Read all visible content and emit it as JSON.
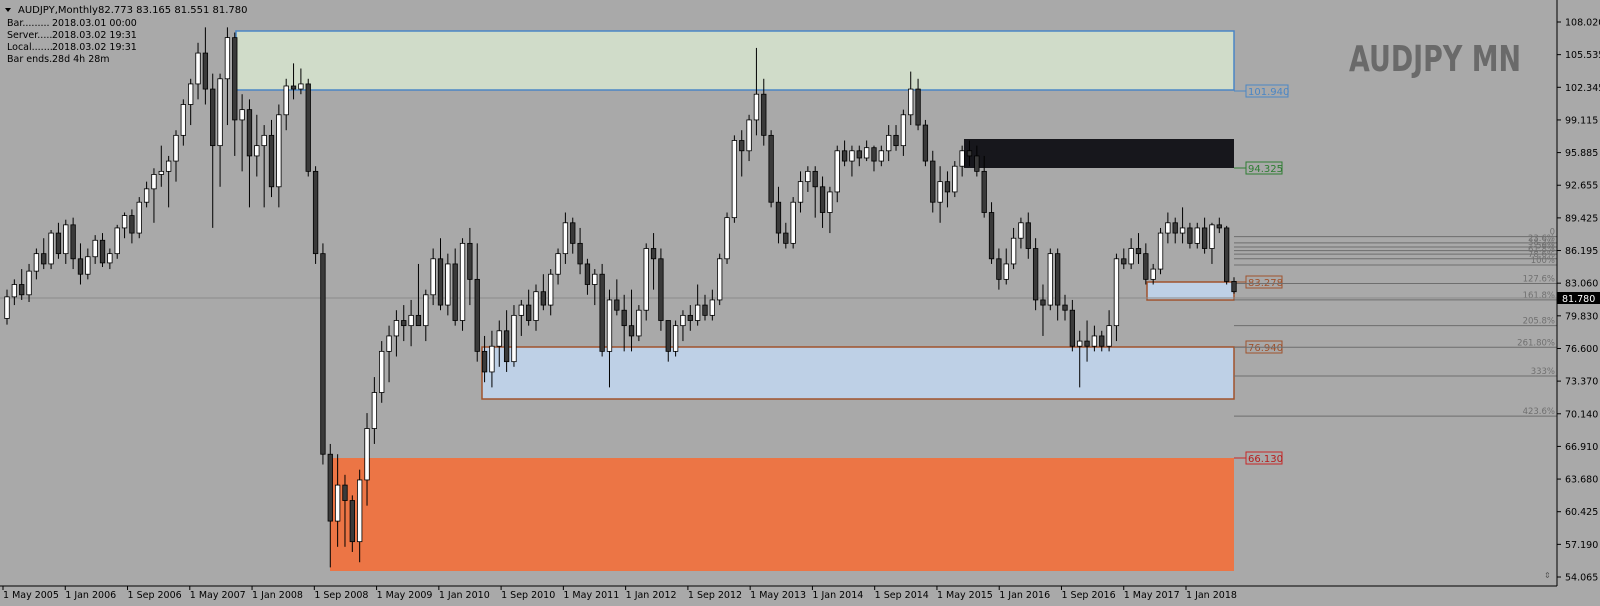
{
  "window": {
    "menu_icon": "triangle-down-icon",
    "symbol": "AUDJPY,Monthly",
    "ohlc": "82.773 83.165 81.551 81.780",
    "watermark": "AUDJPY MN"
  },
  "info_panel": [
    {
      "label": "Bar.........",
      "value": "2018.03.01 00:00"
    },
    {
      "label": "Server.....",
      "value": "2018.03.02 19:31"
    },
    {
      "label": "Local.......",
      "value": "2018.03.02 19:31"
    },
    {
      "label": "Bar ends..",
      "value": "28d 4h 28m"
    }
  ],
  "price_axis": {
    "ticks": [
      "108.020",
      "105.535",
      "102.345",
      "99.115",
      "95.885",
      "92.655",
      "89.425",
      "86.195",
      "83.060",
      "79.830",
      "76.600",
      "73.370",
      "70.140",
      "66.910",
      "63.680",
      "60.425",
      "57.190",
      "54.065"
    ],
    "current_price": "81.780"
  },
  "time_axis": {
    "ticks": [
      "1 May 2005",
      "1 Jan 2006",
      "1 Sep 2006",
      "1 May 2007",
      "1 Jan 2008",
      "1 Sep 2008",
      "1 May 2009",
      "1 Jan 2010",
      "1 Sep 2010",
      "1 May 2011",
      "1 Jan 2012",
      "1 Sep 2012",
      "1 May 2013",
      "1 Jan 2014",
      "1 Sep 2014",
      "1 May 2015",
      "1 Jan 2016",
      "1 Sep 2016",
      "1 May 2017",
      "1 Jan 2018"
    ]
  },
  "zones": [
    {
      "name": "zone-supply-top",
      "label": "101.940",
      "fill": "#d0dcc9",
      "stroke": "#4a86c5",
      "label_color": "#4a86c5"
    },
    {
      "name": "zone-black",
      "label": "94.325",
      "fill": "#17171c",
      "stroke": "#2e7d32",
      "label_color": "#2e7d32"
    },
    {
      "name": "zone-small-demand",
      "label": "83.278",
      "fill": "#bed0e6",
      "stroke": "#a0522d",
      "label_color": "#a0522d"
    },
    {
      "name": "zone-demand-mid",
      "label": "76.940",
      "fill": "#bed0e6",
      "stroke": "#a0522d",
      "label_color": "#a0522d"
    },
    {
      "name": "zone-demand-low",
      "label": "66.130",
      "fill": "#ec7545",
      "stroke": "#c62828",
      "label_color": "#b71c1c"
    }
  ],
  "fib_levels": [
    {
      "label": "0",
      "price": 87.15
    },
    {
      "label": "23.6%",
      "price": 86.55
    },
    {
      "label": "38.2%",
      "price": 86.15
    },
    {
      "label": "50%",
      "price": 85.8
    },
    {
      "label": "61.8%",
      "price": 85.45
    },
    {
      "label": "78.6%",
      "price": 85.0
    },
    {
      "label": "100%",
      "price": 84.4
    },
    {
      "label": "127.6%",
      "price": 82.6
    },
    {
      "label": "161.8%",
      "price": 81.0
    },
    {
      "label": "205.8%",
      "price": 78.5
    },
    {
      "label": "261.80%",
      "price": 76.4
    },
    {
      "label": "333%",
      "price": 73.6
    },
    {
      "label": "423.6%",
      "price": 69.7
    }
  ],
  "colors": {
    "background": "#a9a9a9",
    "bull_candle": "#ffffff",
    "bear_candle": "#3a3a3a",
    "wick": "#000000",
    "price_line": "#8c8c8c",
    "fib_line": "#6e6e6e",
    "fib_text": "#707070"
  },
  "chart_data": {
    "type": "candlestick",
    "title": "AUDJPY,Monthly",
    "ylim": [
      54.065,
      108.02
    ],
    "series": [
      {
        "o": 79.2,
        "h": 82.0,
        "l": 78.6,
        "c": 81.3
      },
      {
        "o": 81.3,
        "h": 83.0,
        "l": 80.5,
        "c": 82.5
      },
      {
        "o": 82.5,
        "h": 84.0,
        "l": 81.0,
        "c": 81.5
      },
      {
        "o": 81.5,
        "h": 84.5,
        "l": 80.8,
        "c": 83.8
      },
      {
        "o": 83.8,
        "h": 86.0,
        "l": 83.0,
        "c": 85.5
      },
      {
        "o": 85.5,
        "h": 87.0,
        "l": 84.0,
        "c": 84.5
      },
      {
        "o": 84.5,
        "h": 87.8,
        "l": 84.0,
        "c": 87.5
      },
      {
        "o": 87.5,
        "h": 88.5,
        "l": 85.0,
        "c": 85.5
      },
      {
        "o": 85.5,
        "h": 88.8,
        "l": 84.5,
        "c": 88.3
      },
      {
        "o": 88.3,
        "h": 89.0,
        "l": 84.0,
        "c": 85.0
      },
      {
        "o": 85.0,
        "h": 86.5,
        "l": 82.5,
        "c": 83.5
      },
      {
        "o": 83.5,
        "h": 86.0,
        "l": 83.0,
        "c": 85.2
      },
      {
        "o": 85.2,
        "h": 87.3,
        "l": 84.5,
        "c": 86.8
      },
      {
        "o": 86.8,
        "h": 87.5,
        "l": 84.2,
        "c": 84.6
      },
      {
        "o": 84.6,
        "h": 86.0,
        "l": 84.0,
        "c": 85.5
      },
      {
        "o": 85.5,
        "h": 88.3,
        "l": 85.0,
        "c": 88.0
      },
      {
        "o": 88.0,
        "h": 89.5,
        "l": 87.0,
        "c": 89.2
      },
      {
        "o": 89.2,
        "h": 89.8,
        "l": 86.5,
        "c": 87.5
      },
      {
        "o": 87.5,
        "h": 91.0,
        "l": 87.0,
        "c": 90.5
      },
      {
        "o": 90.5,
        "h": 92.5,
        "l": 90.0,
        "c": 91.8
      },
      {
        "o": 91.8,
        "h": 93.8,
        "l": 88.5,
        "c": 93.2
      },
      {
        "o": 93.2,
        "h": 96.0,
        "l": 92.0,
        "c": 93.5
      },
      {
        "o": 93.5,
        "h": 95.0,
        "l": 90.0,
        "c": 94.5
      },
      {
        "o": 94.5,
        "h": 97.5,
        "l": 92.5,
        "c": 97.0
      },
      {
        "o": 97.0,
        "h": 100.5,
        "l": 96.0,
        "c": 100.0
      },
      {
        "o": 100.0,
        "h": 102.5,
        "l": 98.0,
        "c": 102.0
      },
      {
        "o": 102.0,
        "h": 106.0,
        "l": 100.5,
        "c": 105.0
      },
      {
        "o": 105.0,
        "h": 107.5,
        "l": 100.0,
        "c": 101.5
      },
      {
        "o": 101.5,
        "h": 103.0,
        "l": 88.0,
        "c": 96.0
      },
      {
        "o": 96.0,
        "h": 103.0,
        "l": 92.0,
        "c": 102.5
      },
      {
        "o": 102.5,
        "h": 107.5,
        "l": 98.0,
        "c": 106.5
      },
      {
        "o": 106.5,
        "h": 107.0,
        "l": 95.0,
        "c": 98.5
      },
      {
        "o": 98.5,
        "h": 101.0,
        "l": 93.5,
        "c": 99.5
      },
      {
        "o": 99.5,
        "h": 100.5,
        "l": 90.0,
        "c": 95.0
      },
      {
        "o": 95.0,
        "h": 99.0,
        "l": 93.0,
        "c": 96.0
      },
      {
        "o": 96.0,
        "h": 98.0,
        "l": 90.0,
        "c": 97.0
      },
      {
        "o": 97.0,
        "h": 98.5,
        "l": 91.0,
        "c": 92.0
      },
      {
        "o": 92.0,
        "h": 100.0,
        "l": 90.0,
        "c": 99.0
      },
      {
        "o": 99.0,
        "h": 102.5,
        "l": 97.5,
        "c": 101.8
      },
      {
        "o": 101.8,
        "h": 104.0,
        "l": 100.5,
        "c": 101.5
      },
      {
        "o": 101.5,
        "h": 103.5,
        "l": 101.0,
        "c": 102.0
      },
      {
        "o": 102.0,
        "h": 102.5,
        "l": 93.0,
        "c": 93.5
      },
      {
        "o": 93.5,
        "h": 94.0,
        "l": 84.5,
        "c": 85.5
      },
      {
        "o": 85.5,
        "h": 86.5,
        "l": 65.0,
        "c": 66.0
      },
      {
        "o": 66.0,
        "h": 67.0,
        "l": 55.0,
        "c": 59.5
      },
      {
        "o": 59.5,
        "h": 66.0,
        "l": 57.0,
        "c": 63.0
      },
      {
        "o": 63.0,
        "h": 64.0,
        "l": 57.0,
        "c": 61.5
      },
      {
        "o": 61.5,
        "h": 62.0,
        "l": 56.5,
        "c": 57.5
      },
      {
        "o": 57.5,
        "h": 64.5,
        "l": 55.5,
        "c": 63.5
      },
      {
        "o": 63.5,
        "h": 70.0,
        "l": 61.0,
        "c": 68.5
      },
      {
        "o": 68.5,
        "h": 73.5,
        "l": 67.0,
        "c": 72.0
      },
      {
        "o": 72.0,
        "h": 77.0,
        "l": 71.0,
        "c": 76.0
      },
      {
        "o": 76.0,
        "h": 78.5,
        "l": 73.0,
        "c": 77.5
      },
      {
        "o": 77.5,
        "h": 80.0,
        "l": 75.5,
        "c": 79.0
      },
      {
        "o": 79.0,
        "h": 80.5,
        "l": 77.0,
        "c": 78.5
      },
      {
        "o": 78.5,
        "h": 81.0,
        "l": 76.5,
        "c": 79.5
      },
      {
        "o": 79.5,
        "h": 84.5,
        "l": 79.0,
        "c": 78.5
      },
      {
        "o": 78.5,
        "h": 82.0,
        "l": 77.0,
        "c": 81.5
      },
      {
        "o": 81.5,
        "h": 86.0,
        "l": 80.5,
        "c": 85.0
      },
      {
        "o": 85.0,
        "h": 87.0,
        "l": 80.0,
        "c": 80.5
      },
      {
        "o": 80.5,
        "h": 85.5,
        "l": 79.5,
        "c": 84.5
      },
      {
        "o": 84.5,
        "h": 86.0,
        "l": 78.5,
        "c": 79.0
      },
      {
        "o": 79.0,
        "h": 87.0,
        "l": 78.0,
        "c": 86.5
      },
      {
        "o": 86.5,
        "h": 88.0,
        "l": 80.5,
        "c": 83.0
      },
      {
        "o": 83.0,
        "h": 86.5,
        "l": 75.0,
        "c": 76.0
      },
      {
        "o": 76.0,
        "h": 77.5,
        "l": 73.0,
        "c": 74.0
      },
      {
        "o": 74.0,
        "h": 78.0,
        "l": 72.5,
        "c": 76.5
      },
      {
        "o": 76.5,
        "h": 79.0,
        "l": 74.5,
        "c": 78.0
      },
      {
        "o": 78.0,
        "h": 80.0,
        "l": 74.0,
        "c": 75.0
      },
      {
        "o": 75.0,
        "h": 80.5,
        "l": 74.5,
        "c": 79.5
      },
      {
        "o": 79.5,
        "h": 81.0,
        "l": 77.5,
        "c": 80.5
      },
      {
        "o": 80.5,
        "h": 82.0,
        "l": 78.5,
        "c": 79.0
      },
      {
        "o": 79.0,
        "h": 82.5,
        "l": 78.0,
        "c": 81.8
      },
      {
        "o": 81.8,
        "h": 83.5,
        "l": 80.0,
        "c": 80.5
      },
      {
        "o": 80.5,
        "h": 84.0,
        "l": 79.5,
        "c": 83.5
      },
      {
        "o": 83.5,
        "h": 86.0,
        "l": 82.5,
        "c": 85.5
      },
      {
        "o": 85.5,
        "h": 89.5,
        "l": 84.5,
        "c": 88.5
      },
      {
        "o": 88.5,
        "h": 89.0,
        "l": 85.5,
        "c": 86.5
      },
      {
        "o": 86.5,
        "h": 88.0,
        "l": 83.5,
        "c": 84.5
      },
      {
        "o": 84.5,
        "h": 85.0,
        "l": 81.5,
        "c": 82.5
      },
      {
        "o": 82.5,
        "h": 84.0,
        "l": 80.5,
        "c": 83.5
      },
      {
        "o": 83.5,
        "h": 84.5,
        "l": 75.5,
        "c": 76.0
      },
      {
        "o": 76.0,
        "h": 82.0,
        "l": 72.5,
        "c": 81.0
      },
      {
        "o": 81.0,
        "h": 83.0,
        "l": 79.5,
        "c": 80.0
      },
      {
        "o": 80.0,
        "h": 81.5,
        "l": 76.0,
        "c": 78.5
      },
      {
        "o": 78.5,
        "h": 82.0,
        "l": 76.0,
        "c": 77.5
      },
      {
        "o": 77.5,
        "h": 80.5,
        "l": 77.0,
        "c": 80.0
      },
      {
        "o": 80.0,
        "h": 86.5,
        "l": 79.0,
        "c": 86.0
      },
      {
        "o": 86.0,
        "h": 87.5,
        "l": 82.0,
        "c": 85.0
      },
      {
        "o": 85.0,
        "h": 86.0,
        "l": 78.0,
        "c": 79.0
      },
      {
        "o": 79.0,
        "h": 78.5,
        "l": 75.0,
        "c": 76.0
      },
      {
        "o": 76.0,
        "h": 79.0,
        "l": 75.5,
        "c": 78.5
      },
      {
        "o": 78.5,
        "h": 80.0,
        "l": 77.0,
        "c": 79.5
      },
      {
        "o": 79.5,
        "h": 80.5,
        "l": 78.0,
        "c": 79.0
      },
      {
        "o": 79.0,
        "h": 82.5,
        "l": 78.5,
        "c": 80.5
      },
      {
        "o": 80.5,
        "h": 81.5,
        "l": 79.0,
        "c": 79.5
      },
      {
        "o": 79.5,
        "h": 82.0,
        "l": 79.0,
        "c": 81.0
      },
      {
        "o": 81.0,
        "h": 85.5,
        "l": 80.5,
        "c": 85.0
      },
      {
        "o": 85.0,
        "h": 89.5,
        "l": 84.5,
        "c": 89.0
      },
      {
        "o": 89.0,
        "h": 97.0,
        "l": 88.5,
        "c": 96.5
      },
      {
        "o": 96.5,
        "h": 97.5,
        "l": 93.0,
        "c": 95.5
      },
      {
        "o": 95.5,
        "h": 99.0,
        "l": 94.5,
        "c": 98.5
      },
      {
        "o": 98.5,
        "h": 105.5,
        "l": 97.0,
        "c": 101.0
      },
      {
        "o": 101.0,
        "h": 102.5,
        "l": 96.0,
        "c": 97.0
      },
      {
        "o": 97.0,
        "h": 97.5,
        "l": 90.0,
        "c": 90.5
      },
      {
        "o": 90.5,
        "h": 92.0,
        "l": 86.5,
        "c": 87.5
      },
      {
        "o": 87.5,
        "h": 88.5,
        "l": 86.0,
        "c": 86.5
      },
      {
        "o": 86.5,
        "h": 91.0,
        "l": 86.0,
        "c": 90.5
      },
      {
        "o": 90.5,
        "h": 93.5,
        "l": 89.5,
        "c": 92.5
      },
      {
        "o": 92.5,
        "h": 94.0,
        "l": 91.5,
        "c": 93.5
      },
      {
        "o": 93.5,
        "h": 94.0,
        "l": 89.0,
        "c": 92.0
      },
      {
        "o": 92.0,
        "h": 93.0,
        "l": 88.0,
        "c": 89.5
      },
      {
        "o": 89.5,
        "h": 92.0,
        "l": 87.5,
        "c": 91.5
      },
      {
        "o": 91.5,
        "h": 96.0,
        "l": 90.5,
        "c": 95.5
      },
      {
        "o": 95.5,
        "h": 96.5,
        "l": 94.0,
        "c": 94.5
      },
      {
        "o": 94.5,
        "h": 96.0,
        "l": 93.0,
        "c": 95.5
      },
      {
        "o": 95.5,
        "h": 96.0,
        "l": 94.0,
        "c": 94.8
      },
      {
        "o": 94.8,
        "h": 96.5,
        "l": 94.5,
        "c": 95.8
      },
      {
        "o": 95.8,
        "h": 96.0,
        "l": 93.5,
        "c": 94.5
      },
      {
        "o": 94.5,
        "h": 96.0,
        "l": 94.0,
        "c": 95.5
      },
      {
        "o": 95.5,
        "h": 98.0,
        "l": 94.5,
        "c": 97.0
      },
      {
        "o": 97.0,
        "h": 98.0,
        "l": 95.5,
        "c": 96.0
      },
      {
        "o": 96.0,
        "h": 99.5,
        "l": 95.0,
        "c": 99.0
      },
      {
        "o": 99.0,
        "h": 103.2,
        "l": 98.0,
        "c": 101.5
      },
      {
        "o": 101.5,
        "h": 102.5,
        "l": 97.5,
        "c": 98.0
      },
      {
        "o": 98.0,
        "h": 98.5,
        "l": 94.0,
        "c": 94.5
      },
      {
        "o": 94.5,
        "h": 95.5,
        "l": 89.5,
        "c": 90.5
      },
      {
        "o": 90.5,
        "h": 94.0,
        "l": 88.5,
        "c": 92.5
      },
      {
        "o": 92.5,
        "h": 93.5,
        "l": 90.0,
        "c": 91.5
      },
      {
        "o": 91.5,
        "h": 94.5,
        "l": 91.0,
        "c": 94.0
      },
      {
        "o": 94.0,
        "h": 96.0,
        "l": 93.0,
        "c": 95.5
      },
      {
        "o": 95.5,
        "h": 96.5,
        "l": 94.0,
        "c": 95.0
      },
      {
        "o": 95.0,
        "h": 96.0,
        "l": 93.0,
        "c": 93.5
      },
      {
        "o": 93.5,
        "h": 95.0,
        "l": 89.0,
        "c": 89.5
      },
      {
        "o": 89.5,
        "h": 90.5,
        "l": 84.5,
        "c": 85.0
      },
      {
        "o": 85.0,
        "h": 86.0,
        "l": 82.0,
        "c": 83.0
      },
      {
        "o": 83.0,
        "h": 86.0,
        "l": 82.5,
        "c": 84.5
      },
      {
        "o": 84.5,
        "h": 88.0,
        "l": 84.0,
        "c": 87.0
      },
      {
        "o": 87.0,
        "h": 89.0,
        "l": 86.0,
        "c": 88.5
      },
      {
        "o": 88.5,
        "h": 89.5,
        "l": 85.0,
        "c": 86.0
      },
      {
        "o": 86.0,
        "h": 87.0,
        "l": 80.0,
        "c": 81.0
      },
      {
        "o": 81.0,
        "h": 82.5,
        "l": 77.5,
        "c": 80.5
      },
      {
        "o": 80.5,
        "h": 86.0,
        "l": 80.0,
        "c": 85.5
      },
      {
        "o": 85.5,
        "h": 86.0,
        "l": 79.0,
        "c": 80.5
      },
      {
        "o": 80.5,
        "h": 81.5,
        "l": 79.0,
        "c": 80.0
      },
      {
        "o": 80.0,
        "h": 81.0,
        "l": 76.0,
        "c": 76.5
      },
      {
        "o": 76.5,
        "h": 78.0,
        "l": 72.5,
        "c": 77.0
      },
      {
        "o": 77.0,
        "h": 79.0,
        "l": 75.0,
        "c": 76.5
      },
      {
        "o": 76.5,
        "h": 78.5,
        "l": 76.0,
        "c": 77.5
      },
      {
        "o": 77.5,
        "h": 78.0,
        "l": 76.0,
        "c": 76.5
      },
      {
        "o": 76.5,
        "h": 80.0,
        "l": 76.0,
        "c": 78.5
      },
      {
        "o": 78.5,
        "h": 85.5,
        "l": 77.0,
        "c": 85.0
      },
      {
        "o": 85.0,
        "h": 86.0,
        "l": 84.0,
        "c": 84.5
      },
      {
        "o": 84.5,
        "h": 87.0,
        "l": 84.0,
        "c": 86.0
      },
      {
        "o": 86.0,
        "h": 87.5,
        "l": 84.5,
        "c": 85.5
      },
      {
        "o": 85.5,
        "h": 86.5,
        "l": 82.5,
        "c": 83.0
      },
      {
        "o": 83.0,
        "h": 84.5,
        "l": 82.5,
        "c": 84.0
      },
      {
        "o": 84.0,
        "h": 88.0,
        "l": 83.5,
        "c": 87.5
      },
      {
        "o": 87.5,
        "h": 89.5,
        "l": 86.5,
        "c": 88.5
      },
      {
        "o": 88.5,
        "h": 89.0,
        "l": 86.5,
        "c": 87.5
      },
      {
        "o": 87.5,
        "h": 90.0,
        "l": 86.5,
        "c": 88.0
      },
      {
        "o": 88.0,
        "h": 88.5,
        "l": 86.0,
        "c": 86.5
      },
      {
        "o": 86.5,
        "h": 88.5,
        "l": 86.0,
        "c": 88.0
      },
      {
        "o": 88.0,
        "h": 89.0,
        "l": 85.5,
        "c": 86.0
      },
      {
        "o": 86.0,
        "h": 88.5,
        "l": 84.5,
        "c": 88.3
      },
      {
        "o": 88.3,
        "h": 89.0,
        "l": 87.5,
        "c": 88.0
      },
      {
        "o": 88.0,
        "h": 88.2,
        "l": 82.5,
        "c": 82.8
      },
      {
        "o": 82.8,
        "h": 83.2,
        "l": 81.6,
        "c": 81.8
      }
    ]
  }
}
